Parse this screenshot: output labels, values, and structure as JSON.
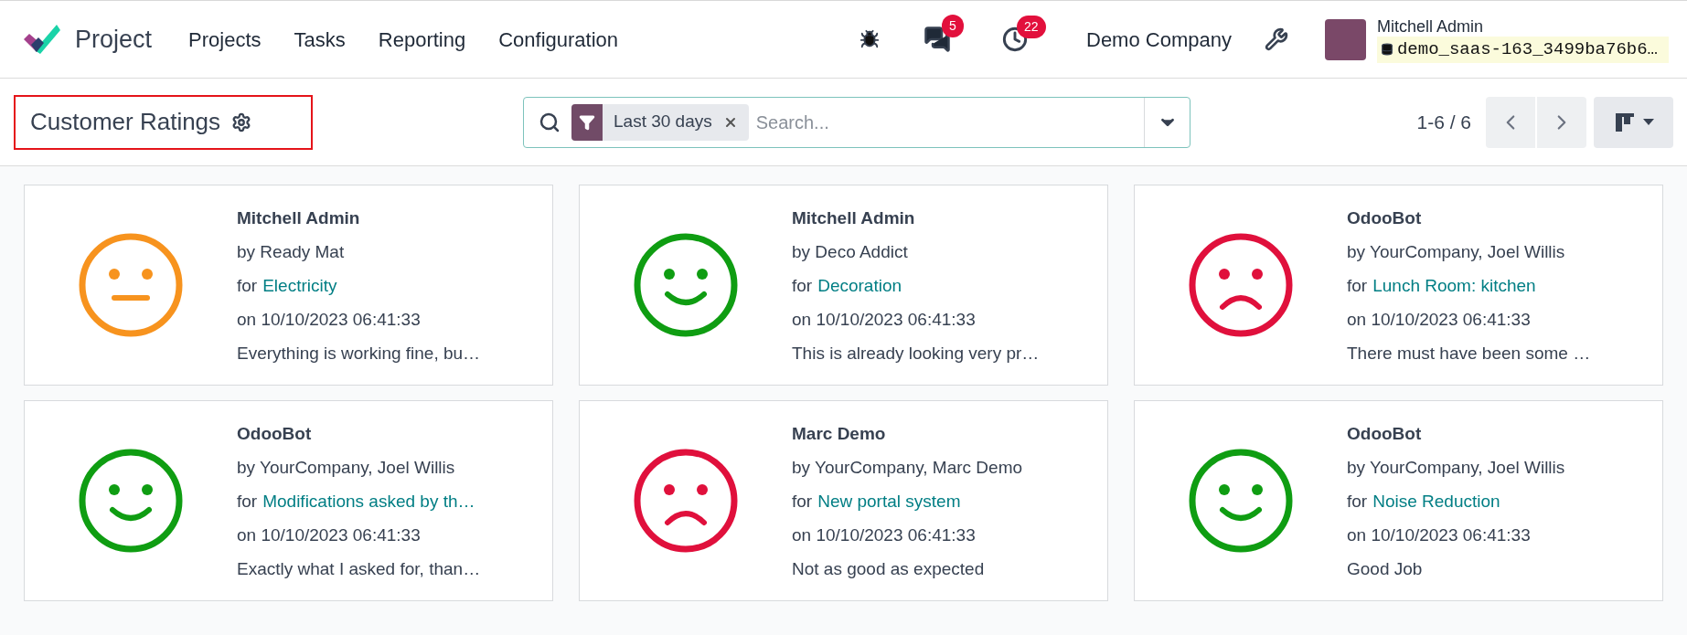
{
  "app": {
    "name": "Project"
  },
  "menu": [
    "Projects",
    "Tasks",
    "Reporting",
    "Configuration"
  ],
  "systray": {
    "messages_count": "5",
    "activities_count": "22",
    "company": "Demo Company",
    "user": "Mitchell Admin",
    "database": "demo_saas-163_3499ba76b6…"
  },
  "control_panel": {
    "title": "Customer Ratings",
    "filter": "Last 30 days",
    "search_placeholder": "Search...",
    "pager": "1-6 / 6"
  },
  "ratings": [
    {
      "kind": "okay",
      "partner": "Mitchell Admin",
      "by": "by Ready Mat",
      "for_label": "for",
      "task": "Electricity",
      "date": "on 10/10/2023 06:41:33",
      "feedback": "Everything is working fine, bu…"
    },
    {
      "kind": "satisfied",
      "partner": "Mitchell Admin",
      "by": "by Deco Addict",
      "for_label": "for",
      "task": "Decoration",
      "date": "on 10/10/2023 06:41:33",
      "feedback": "This is already looking very pr…"
    },
    {
      "kind": "dissatisfied",
      "partner": "OdooBot",
      "by": "by YourCompany, Joel Willis",
      "for_label": "for",
      "task": "Lunch Room: kitchen",
      "date": "on 10/10/2023 06:41:33",
      "feedback": "There must have been some …"
    },
    {
      "kind": "satisfied",
      "partner": "OdooBot",
      "by": "by YourCompany, Joel Willis",
      "for_label": "for",
      "task": "Modifications asked by th…",
      "date": "on 10/10/2023 06:41:33",
      "feedback": "Exactly what I asked for, than…"
    },
    {
      "kind": "dissatisfied",
      "partner": "Marc Demo",
      "by": "by YourCompany, Marc Demo",
      "for_label": "for",
      "task": "New portal system",
      "date": "on 10/10/2023 06:41:33",
      "feedback": "Not as good as expected"
    },
    {
      "kind": "satisfied",
      "partner": "OdooBot",
      "by": "by YourCompany, Joel Willis",
      "for_label": "for",
      "task": "Noise Reduction",
      "date": "on 10/10/2023 06:41:33",
      "feedback": "Good Job"
    }
  ]
}
